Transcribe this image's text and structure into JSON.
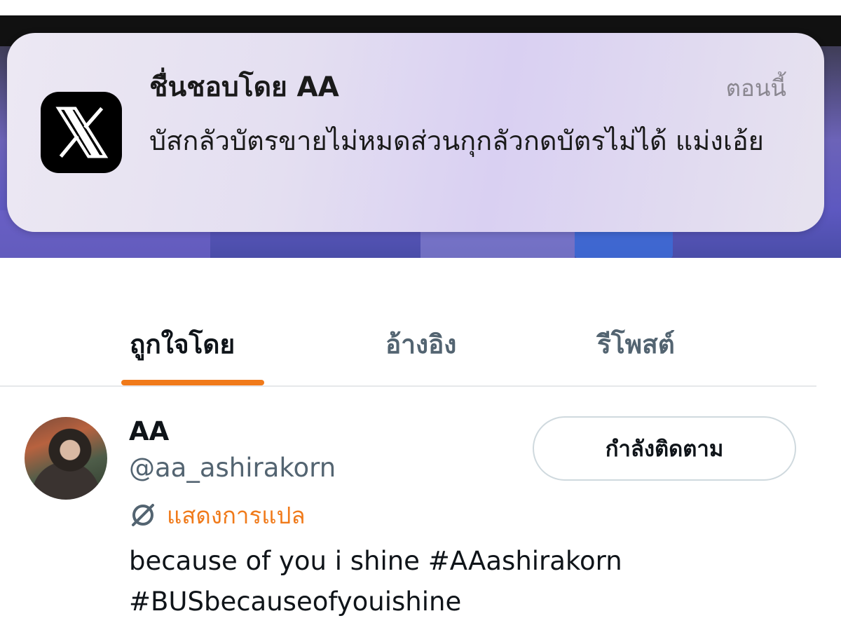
{
  "notification": {
    "app_icon": "x-logo-icon",
    "title": "ชื่นชอบโดย AA",
    "time": "ตอนนี้",
    "body": "บัสกลัวบัตรขายไม่หมดส่วนกุกลัวกดบัตรไม่ได้ แม่งเอ้ย"
  },
  "tabs": [
    {
      "label": "ถูกใจโดย",
      "active": true
    },
    {
      "label": "อ้างอิง",
      "active": false
    },
    {
      "label": "รีโพสต์",
      "active": false
    }
  ],
  "user": {
    "name": "AA",
    "handle": "@aa_ashirakorn",
    "follow_label": "กำลังติดตาม",
    "translate_label": "แสดงการแปล",
    "translate_icon": "globe-slash-icon",
    "bio": "because of you i shine #AAashirakorn #BUSbecauseofyouishine"
  },
  "colors": {
    "accent": "#f07a1a",
    "secondary_text": "#536471",
    "primary_text": "#0f1419"
  }
}
